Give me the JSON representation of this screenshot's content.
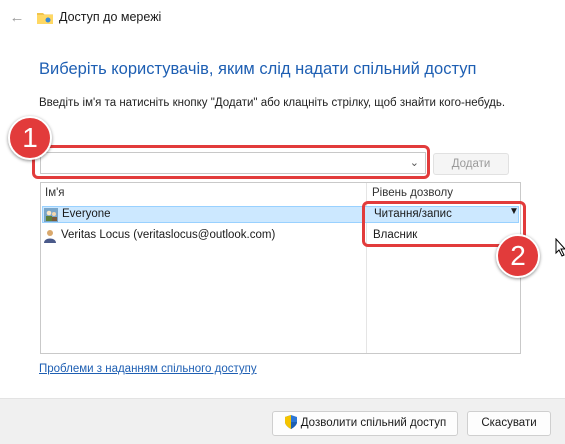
{
  "window": {
    "title": "Доступ до мережі"
  },
  "heading": "Виберіть користувачів, яким слід надати спільний доступ",
  "instructions": "Введіть ім'я та натисніть кнопку \"Додати\" або клацніть стрілку, щоб знайти кого-небудь.",
  "add_button": "Додати",
  "table": {
    "columns": [
      "Ім'я",
      "Рівень дозволу"
    ],
    "rows": [
      {
        "name": "Everyone",
        "permission": "Читання/запис"
      },
      {
        "name": "Veritas Locus (veritaslocus@outlook.com)",
        "permission": "Власник"
      }
    ]
  },
  "help_link": "Проблеми з наданням спільного доступу",
  "footer": {
    "share_button": "Дозволити спільний доступ",
    "cancel_button": "Скасувати"
  },
  "annotations": {
    "badge1": "1",
    "badge2": "2",
    "color": "#e23b3b"
  }
}
